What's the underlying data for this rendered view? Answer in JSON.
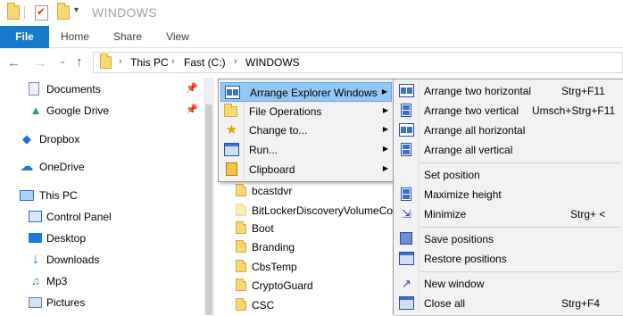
{
  "window": {
    "title": "WINDOWS"
  },
  "quick_access": {
    "dropdown_glyph": "▾"
  },
  "ribbon": {
    "tabs": [
      "File",
      "Home",
      "Share",
      "View"
    ]
  },
  "nav": {
    "back": "←",
    "forward": "→",
    "recent": "⌄",
    "up": "↑"
  },
  "address": {
    "crumbs": [
      "This PC",
      "Fast (C:)",
      "WINDOWS"
    ],
    "separator": "›"
  },
  "sidebar": {
    "items": [
      {
        "label": "Documents",
        "icon": "documents-icon",
        "pinned": true
      },
      {
        "label": "Google Drive",
        "icon": "google-drive-icon",
        "pinned": true
      },
      {
        "label": "Dropbox",
        "icon": "dropbox-icon"
      },
      {
        "label": "OneDrive",
        "icon": "onedrive-icon"
      },
      {
        "label": "This PC",
        "icon": "this-pc-icon"
      },
      {
        "label": "Control Panel",
        "icon": "control-panel-icon"
      },
      {
        "label": "Desktop",
        "icon": "desktop-icon"
      },
      {
        "label": "Downloads",
        "icon": "downloads-icon"
      },
      {
        "label": "Mp3",
        "icon": "music-icon"
      },
      {
        "label": "Pictures",
        "icon": "pictures-icon"
      }
    ]
  },
  "files": [
    {
      "name": "bcastdvr",
      "pale": false
    },
    {
      "name": "BitLockerDiscoveryVolumeContents",
      "pale": true
    },
    {
      "name": "Boot",
      "pale": false
    },
    {
      "name": "Branding",
      "pale": false
    },
    {
      "name": "CbsTemp",
      "pale": false
    },
    {
      "name": "CryptoGuard",
      "pale": false
    },
    {
      "name": "CSC",
      "pale": false
    }
  ],
  "context_menu": {
    "items": [
      {
        "label": "Arrange Explorer Windows",
        "icon": "windows-arrange-icon",
        "highlighted": true
      },
      {
        "label": "File Operations",
        "icon": "folder-icon"
      },
      {
        "label": "Change to...",
        "icon": "star-icon"
      },
      {
        "label": "Run...",
        "icon": "run-icon"
      },
      {
        "label": "Clipboard",
        "icon": "clipboard-icon"
      }
    ]
  },
  "submenu": {
    "items": [
      {
        "label": "Arrange two horizontal",
        "shortcut": "Strg+F11",
        "icon": "arrange-horizontal-icon"
      },
      {
        "label": "Arrange two vertical",
        "shortcut": "Umsch+Strg+F11",
        "icon": "arrange-vertical-icon"
      },
      {
        "label": "Arrange all horizontal",
        "shortcut": "",
        "icon": "arrange-all-horizontal-icon"
      },
      {
        "label": "Arrange all vertical",
        "shortcut": "",
        "icon": "arrange-all-vertical-icon"
      },
      {
        "label": "Set position",
        "shortcut": "",
        "icon": ""
      },
      {
        "label": "Maximize height",
        "shortcut": "",
        "icon": "maximize-height-icon"
      },
      {
        "label": "Minimize",
        "shortcut": "Strg+ <",
        "icon": "minimize-icon"
      },
      {
        "label": "Save positions",
        "shortcut": "",
        "icon": "save-positions-icon"
      },
      {
        "label": "Restore positions",
        "shortcut": "",
        "icon": "restore-positions-icon"
      },
      {
        "label": "New window",
        "shortcut": "",
        "icon": "new-window-icon"
      },
      {
        "label": "Close all",
        "shortcut": "Strg+F4",
        "icon": "close-all-icon"
      }
    ]
  },
  "colors": {
    "file_tab": "#1979ca",
    "menu_highlight": "#91c9f7",
    "folder": "#f8d775"
  }
}
